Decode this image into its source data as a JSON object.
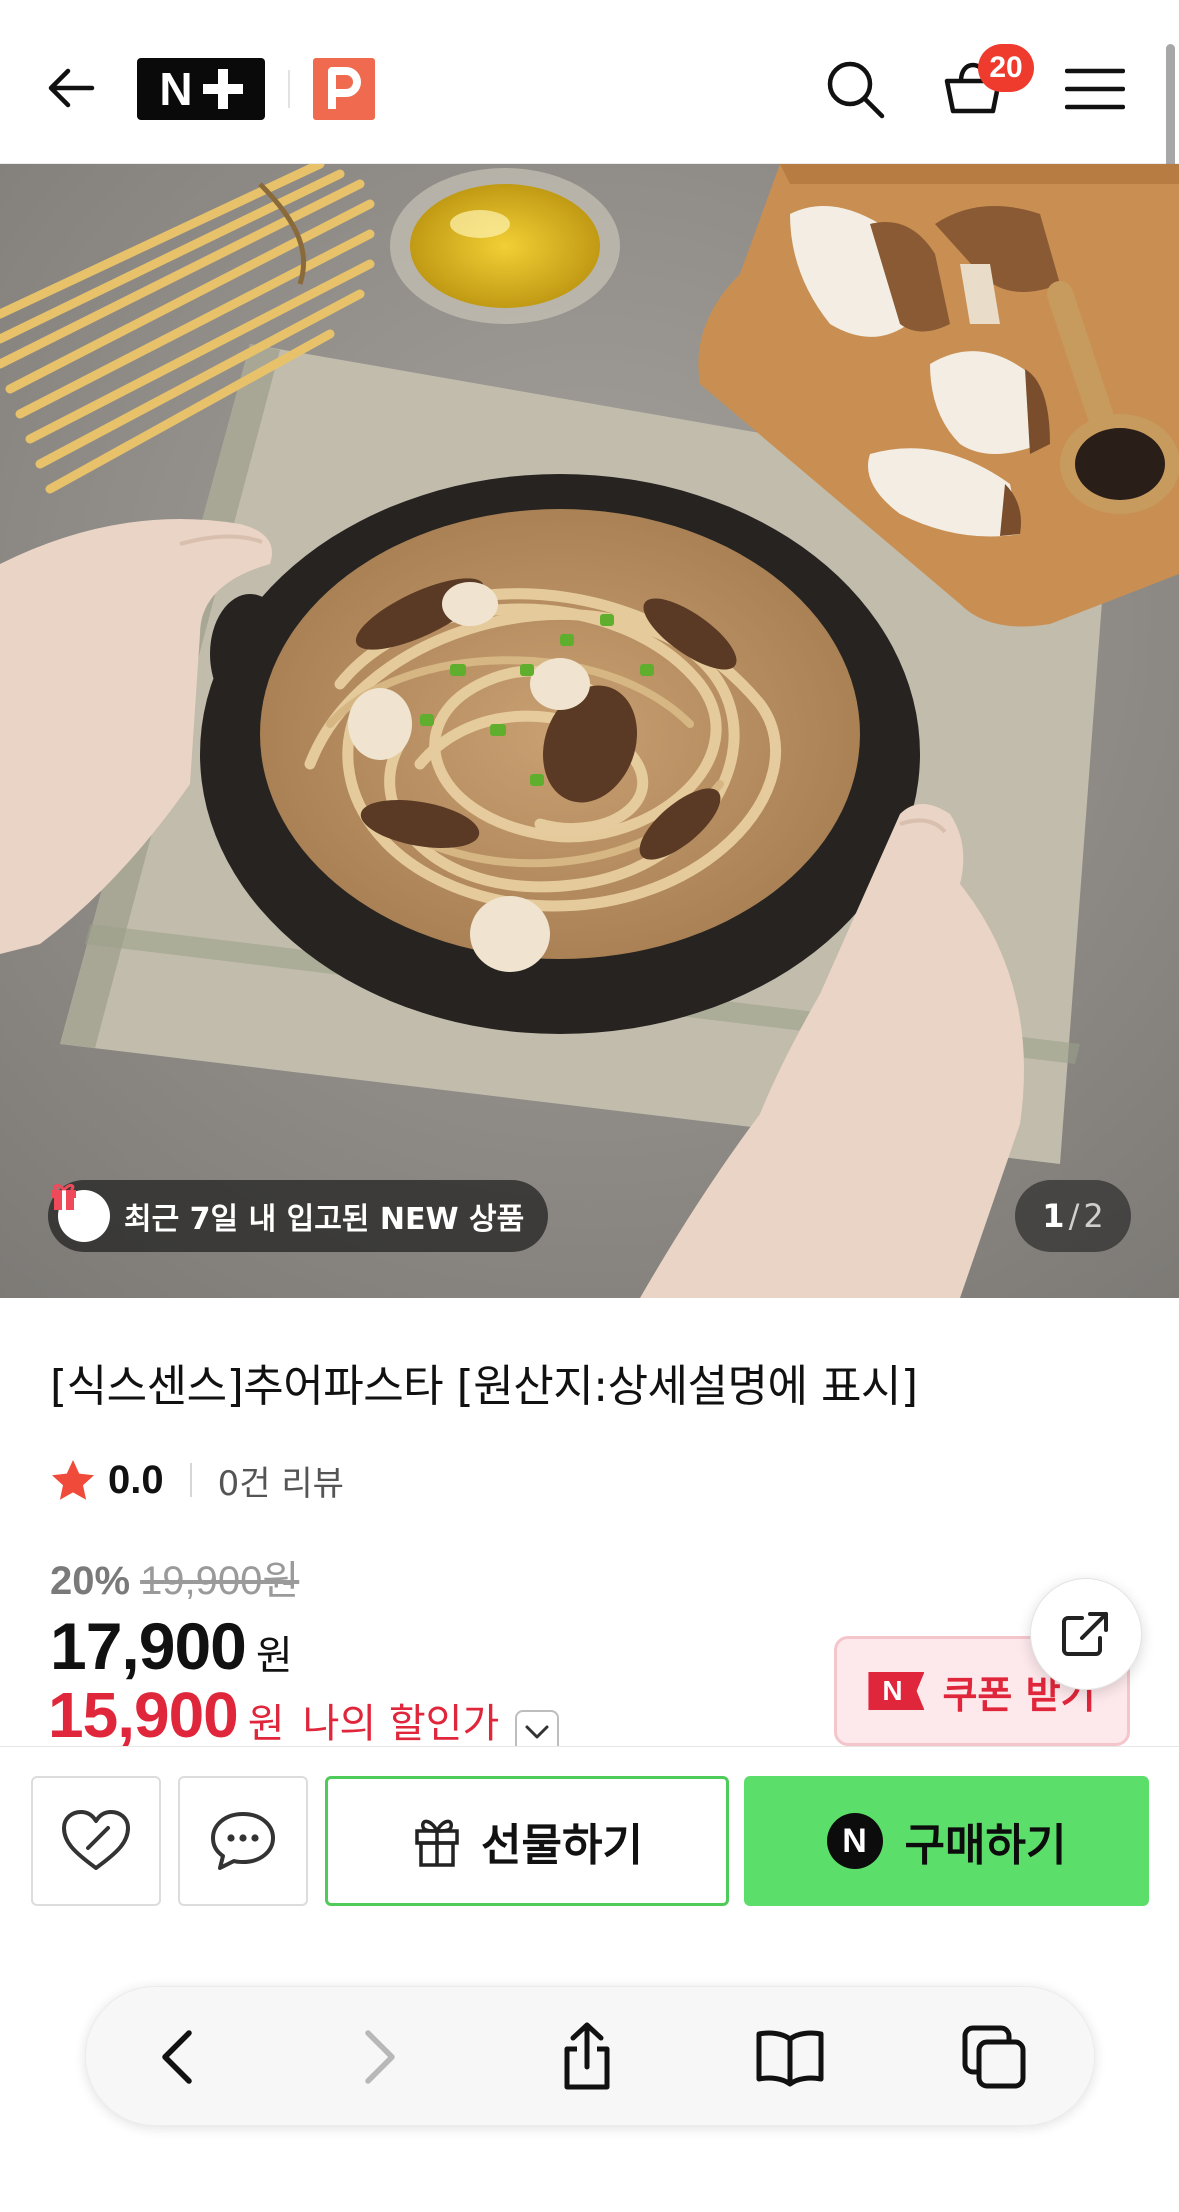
{
  "header": {
    "logo_nplus": "N",
    "cart_count": "20"
  },
  "hero": {
    "new_badge_text": "최근 7일 내 입고된 NEW 상품",
    "page_current": "1",
    "page_separator": "/",
    "page_total": "2"
  },
  "product": {
    "title": "[식스센스]추어파스타 [원산지:상세설명에 표시]",
    "rating": "0.0",
    "review_count": "0건 리뷰",
    "discount_rate": "20%",
    "original_price": "19,900원",
    "price": "17,900",
    "price_unit": "원",
    "my_price": "15,900",
    "my_price_unit": "원",
    "my_price_label": "나의 할인가"
  },
  "coupon": {
    "mark": "N",
    "label": "쿠폰 받기"
  },
  "actions": {
    "gift_label": "선물하기",
    "buy_mark": "N",
    "buy_label": "구매하기"
  },
  "colors": {
    "accent_red": "#e0263b",
    "buy_green": "#5cde6a",
    "badge_red": "#ef3b2d",
    "logo_orange": "#ef6a4f"
  }
}
